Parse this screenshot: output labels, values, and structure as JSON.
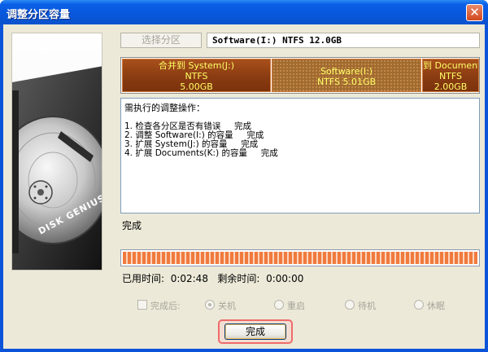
{
  "window": {
    "title": "调整分区容量"
  },
  "top": {
    "select_partition_label": "选择分区",
    "partition_title": "Software(I:) NTFS 12.0GB"
  },
  "partitions": [
    {
      "name": "合并到 System(J:)",
      "fs": "NTFS",
      "size": "5.00GB"
    },
    {
      "name": "Software(I:)",
      "fs_size": "NTFS 5.01GB"
    },
    {
      "name": "到 Document",
      "fs": "NTFS",
      "size": "2.00GB"
    }
  ],
  "operations": {
    "header": "需执行的调整操作：",
    "items": [
      "1. 检查各分区是否有错误     完成",
      "2. 调整 Software(I:) 的容量     完成",
      "3. 扩展 System(J:) 的容量     完成",
      "4. 扩展 Documents(K:) 的容量     完成"
    ]
  },
  "status": "完成",
  "progress": {
    "fraction": 1.0
  },
  "times": {
    "elapsed_label": "已用时间:",
    "elapsed": "0:02:48",
    "remaining_label": "剩余时间:",
    "remaining": "0:00:00"
  },
  "after_options": {
    "checkbox_label": "完成后:",
    "shutdown": "关机",
    "restart": "重启",
    "standby": "待机",
    "hibernate": "休眠"
  },
  "finish_button": "完成",
  "brand": {
    "logo_text": "DISK GENIUS"
  }
}
